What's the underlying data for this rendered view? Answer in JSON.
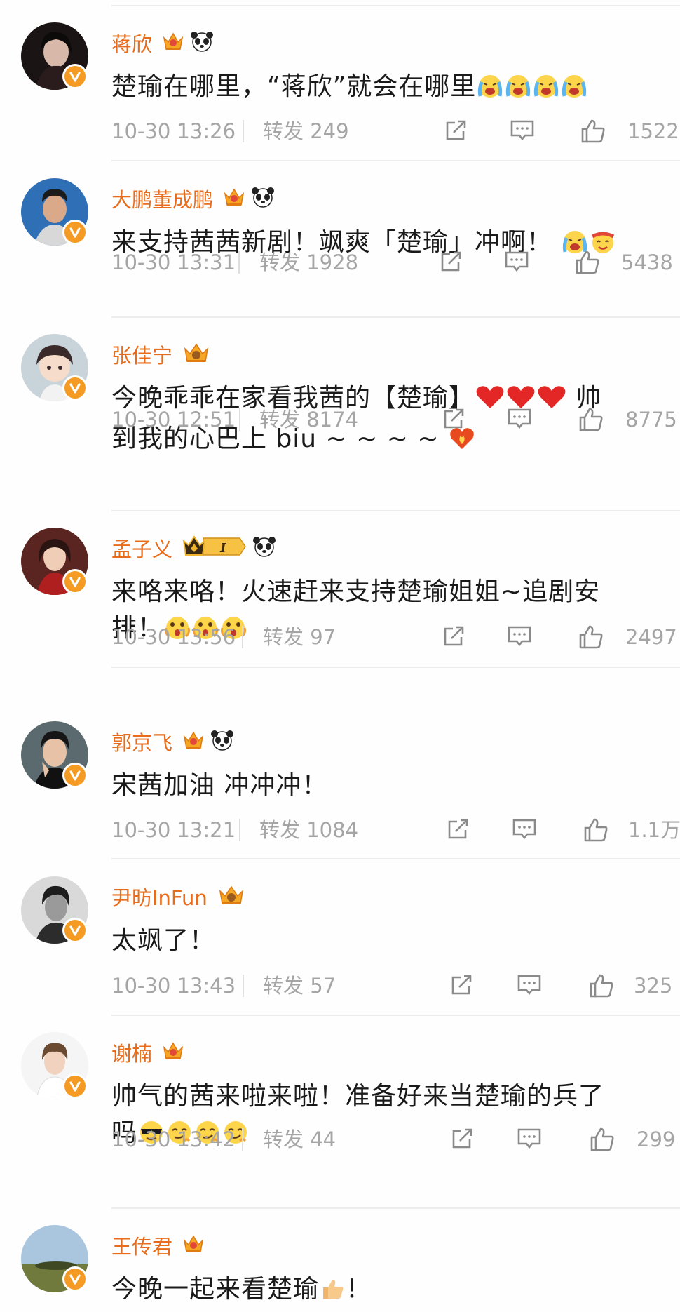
{
  "comments": [
    {
      "username": "蒋欣",
      "text": "楚瑜在哪里，“蒋欣”就会在哪里",
      "emojis": [
        "crying-laugh-emoji",
        "crying-laugh-emoji",
        "crying-laugh-emoji",
        "crying-laugh-emoji"
      ],
      "time": "10-30 13:26",
      "repost_label": "转发",
      "repost_count": "249",
      "likes": "1522",
      "badges": [
        "crown-badge",
        "panda-badge"
      ]
    },
    {
      "username": "大鹏董成鹏",
      "text": "来支持茜茜新剧！飒爽「楚瑜」冲啊！",
      "emojis": [
        "crying-laugh-emoji",
        "cheer-emoji"
      ],
      "time": "10-30 13:31",
      "repost_label": "转发",
      "repost_count": "1928",
      "likes": "5438",
      "badges": [
        "crown-badge",
        "panda-badge"
      ]
    },
    {
      "username": "张佳宁",
      "text": "今晚乖乖在家看我茜的【楚瑜】",
      "text_after_hearts": " 帅",
      "text_line2": "到我的心巴上 biu ~ ~ ~ ~",
      "emojis": [
        "heart-emoji",
        "heart-emoji",
        "heart-emoji",
        "fire-heart-emoji"
      ],
      "time": "10-30 12:51",
      "repost_label": "转发",
      "repost_count": "8174",
      "likes": "8775",
      "badges": [
        "crown-badge"
      ]
    },
    {
      "username": "孟子义",
      "text": "来咯来咯！火速赶来支持楚瑜姐姐~追剧安",
      "text_line2": "排！",
      "emojis": [
        "wow-emoji",
        "wow-emoji",
        "wow-emoji"
      ],
      "time": "10-30 13:56",
      "repost_label": "转发",
      "repost_count": "97",
      "likes": "2497",
      "badges": [
        "crown-level-badge",
        "panda-badge"
      ],
      "level_label": "I"
    },
    {
      "username": "郭京飞",
      "text": "宋茜加油 冲冲冲！",
      "time": "10-30 13:21",
      "repost_label": "转发",
      "repost_count": "1084",
      "likes": "1.1万",
      "badges": [
        "crown-badge",
        "panda-badge"
      ]
    },
    {
      "username": "尹昉InFun",
      "text": "太飒了！",
      "time": "10-30 13:43",
      "repost_label": "转发",
      "repost_count": "57",
      "likes": "325",
      "badges": [
        "crown-badge"
      ]
    },
    {
      "username": "谢楠",
      "text": "帅气的茜来啦来啦！准备好来当楚瑜的兵了",
      "text_line2": "吗",
      "emojis": [
        "cool-emoji",
        "smug-emoji",
        "smug-emoji",
        "smug-emoji"
      ],
      "time": "10-30 13:42",
      "repost_label": "转发",
      "repost_count": "44",
      "likes": "299",
      "badges": [
        "crown-badge"
      ]
    },
    {
      "username": "王传君",
      "text": "今晚一起来看楚瑜",
      "text_tail": "！",
      "emojis": [
        "thumbs-up-emoji"
      ],
      "badges": [
        "crown-badge"
      ]
    }
  ],
  "colors": {
    "username": "#e86c1b",
    "text": "#1a1a1a",
    "meta": "#a5a5a5",
    "verified": "#f59a22",
    "divider": "#ededed"
  }
}
